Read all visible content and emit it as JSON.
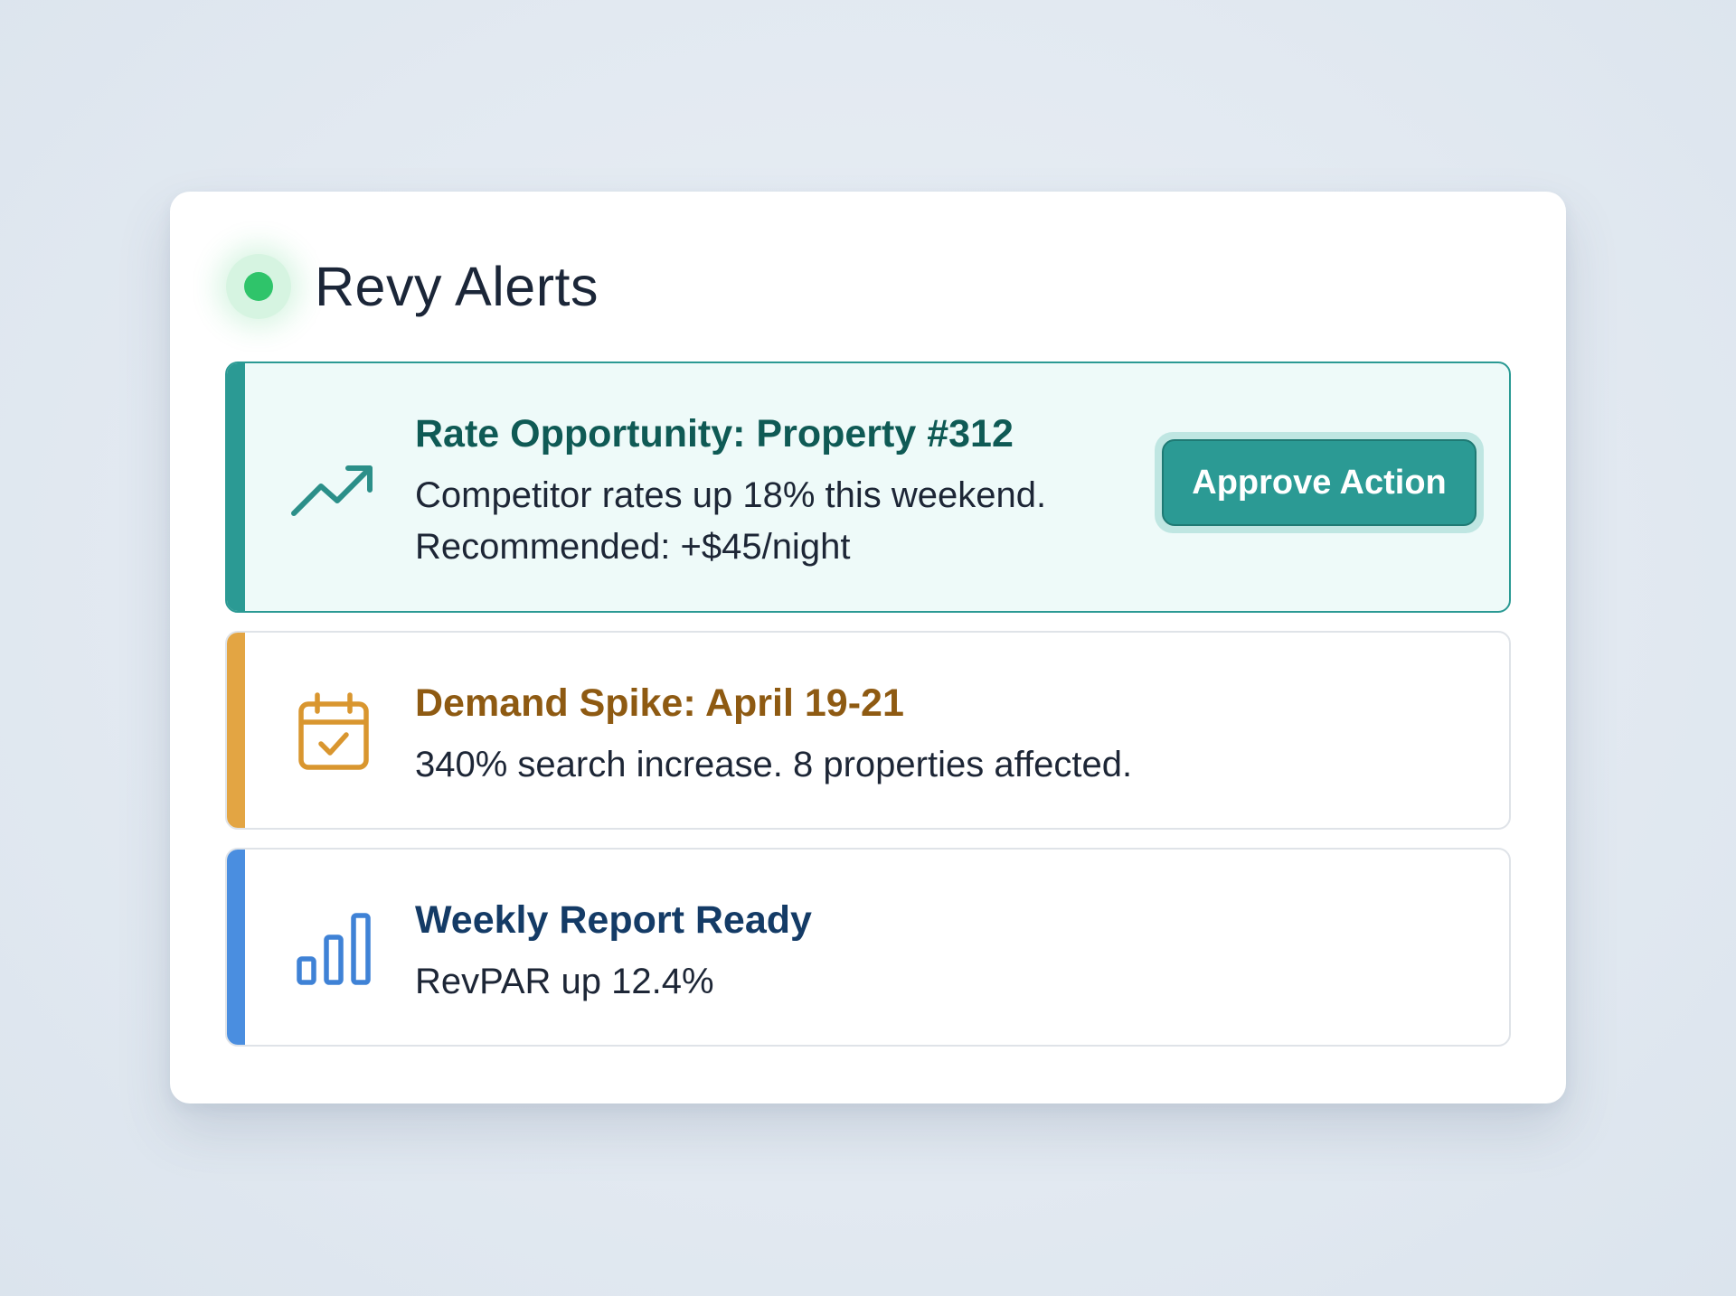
{
  "panel": {
    "title": "Revy Alerts",
    "status_color": "#2fc46a"
  },
  "alerts": [
    {
      "title": "Rate Opportunity: Property #312",
      "lines": [
        "Competitor rates up 18% this weekend.",
        "Recommended: +$45/night"
      ],
      "icon": "trending-up-icon",
      "accent": "#2b9a94",
      "action_label": "Approve Action"
    },
    {
      "title": "Demand Spike: April 19-21",
      "lines": [
        "340% search increase. 8 properties affected."
      ],
      "icon": "calendar-check-icon",
      "accent": "#e3a543"
    },
    {
      "title": "Weekly Report Ready",
      "lines": [
        "RevPAR up 12.4%"
      ],
      "icon": "bar-chart-icon",
      "accent": "#4a8ee0"
    }
  ]
}
